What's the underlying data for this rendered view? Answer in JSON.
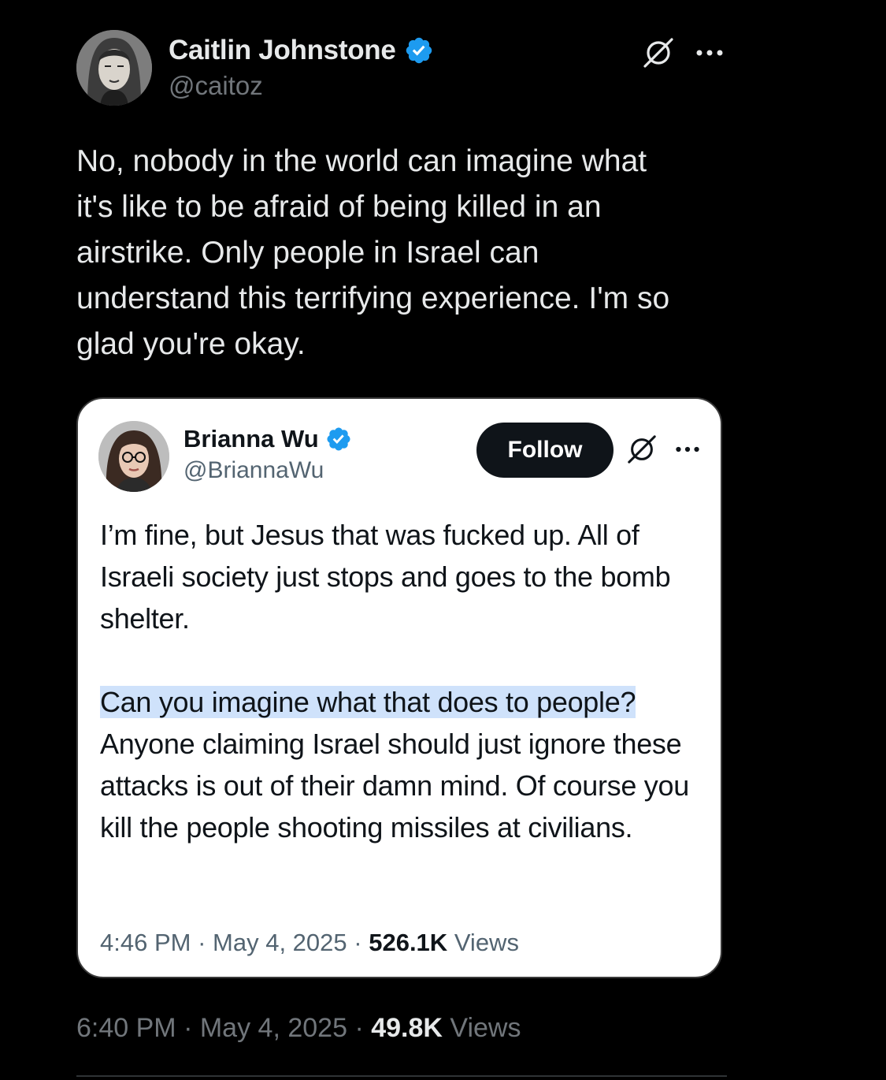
{
  "tweet": {
    "display_name": "Caitlin Johnstone",
    "handle": "@caitoz",
    "text": "No, nobody in the world can imagine what\nit's like to be afraid of being killed in an\nairstrike. Only people in Israel can\nunderstand this terrifying experience. I'm so\nglad you're okay.",
    "time": "6:40 PM",
    "date": "May 4, 2025",
    "views_count": "49.8K",
    "views_label": "Views",
    "separator": "·"
  },
  "quote": {
    "display_name": "Brianna Wu",
    "handle": "@BriannaWu",
    "follow_label": "Follow",
    "para1": "I’m fine, but Jesus that was fucked up. All of Israeli society just stops and goes to the bomb shelter.",
    "para2_highlight": "Can you imagine what that does to people?",
    "para2_rest": "Anyone claiming Israel should just ignore these attacks is out of their damn mind. Of course you kill the people shooting missiles at civilians.",
    "time": "4:46 PM",
    "date": "May 4, 2025",
    "views_count": "526.1K",
    "views_label": "Views",
    "separator": "·"
  },
  "colors": {
    "background": "#000000",
    "verified_blue": "#1d9bf0",
    "highlight": "#cfe2fb",
    "muted_dark": "#71767b",
    "muted_light": "#536471"
  },
  "icons": {
    "verified": "verified-badge-icon",
    "grok": "grok-icon",
    "more": "more-options-icon"
  }
}
